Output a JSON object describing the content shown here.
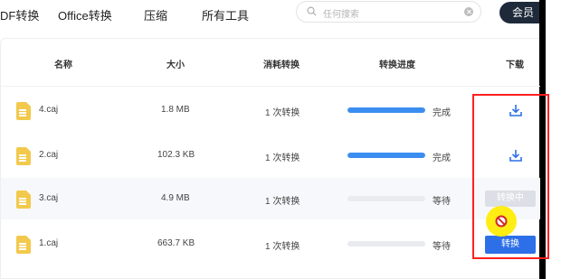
{
  "nav": {
    "items": [
      "DF转换",
      "Office转换",
      "压缩",
      "所有工具"
    ],
    "search_placeholder": "任何搜索",
    "member_label": "会员"
  },
  "table": {
    "headers": {
      "name": "名称",
      "size": "大小",
      "conversions": "消耗转换",
      "progress": "转换进度",
      "download": "下载"
    },
    "rows": [
      {
        "name": "4.caj",
        "size": "1.8 MB",
        "conversions": "1 次转换",
        "progress": 1.0,
        "status": "完成",
        "action": "download"
      },
      {
        "name": "2.caj",
        "size": "102.3 KB",
        "conversions": "1 次转换",
        "progress": 1.0,
        "status": "完成",
        "action": "download"
      },
      {
        "name": "3.caj",
        "size": "4.9 MB",
        "conversions": "1 次转换",
        "progress": 0.0,
        "status": "等待",
        "action": "disabled",
        "action_label": "转换中"
      },
      {
        "name": "1.caj",
        "size": "663.7 KB",
        "conversions": "1 次转换",
        "progress": 0.0,
        "status": "等待",
        "action": "convert",
        "action_label": "转换"
      }
    ]
  },
  "colors": {
    "accent": "#2d6fe8",
    "progress_fill": "#3b8ef0",
    "file_icon": "#f2c94c",
    "highlight_box": "#ff1f1f",
    "cursor_highlight": "#ffeb00"
  },
  "icons": {
    "search": "search-icon",
    "download": "download-icon",
    "file": "file-icon",
    "cursor": "not-allowed-cursor-icon"
  }
}
